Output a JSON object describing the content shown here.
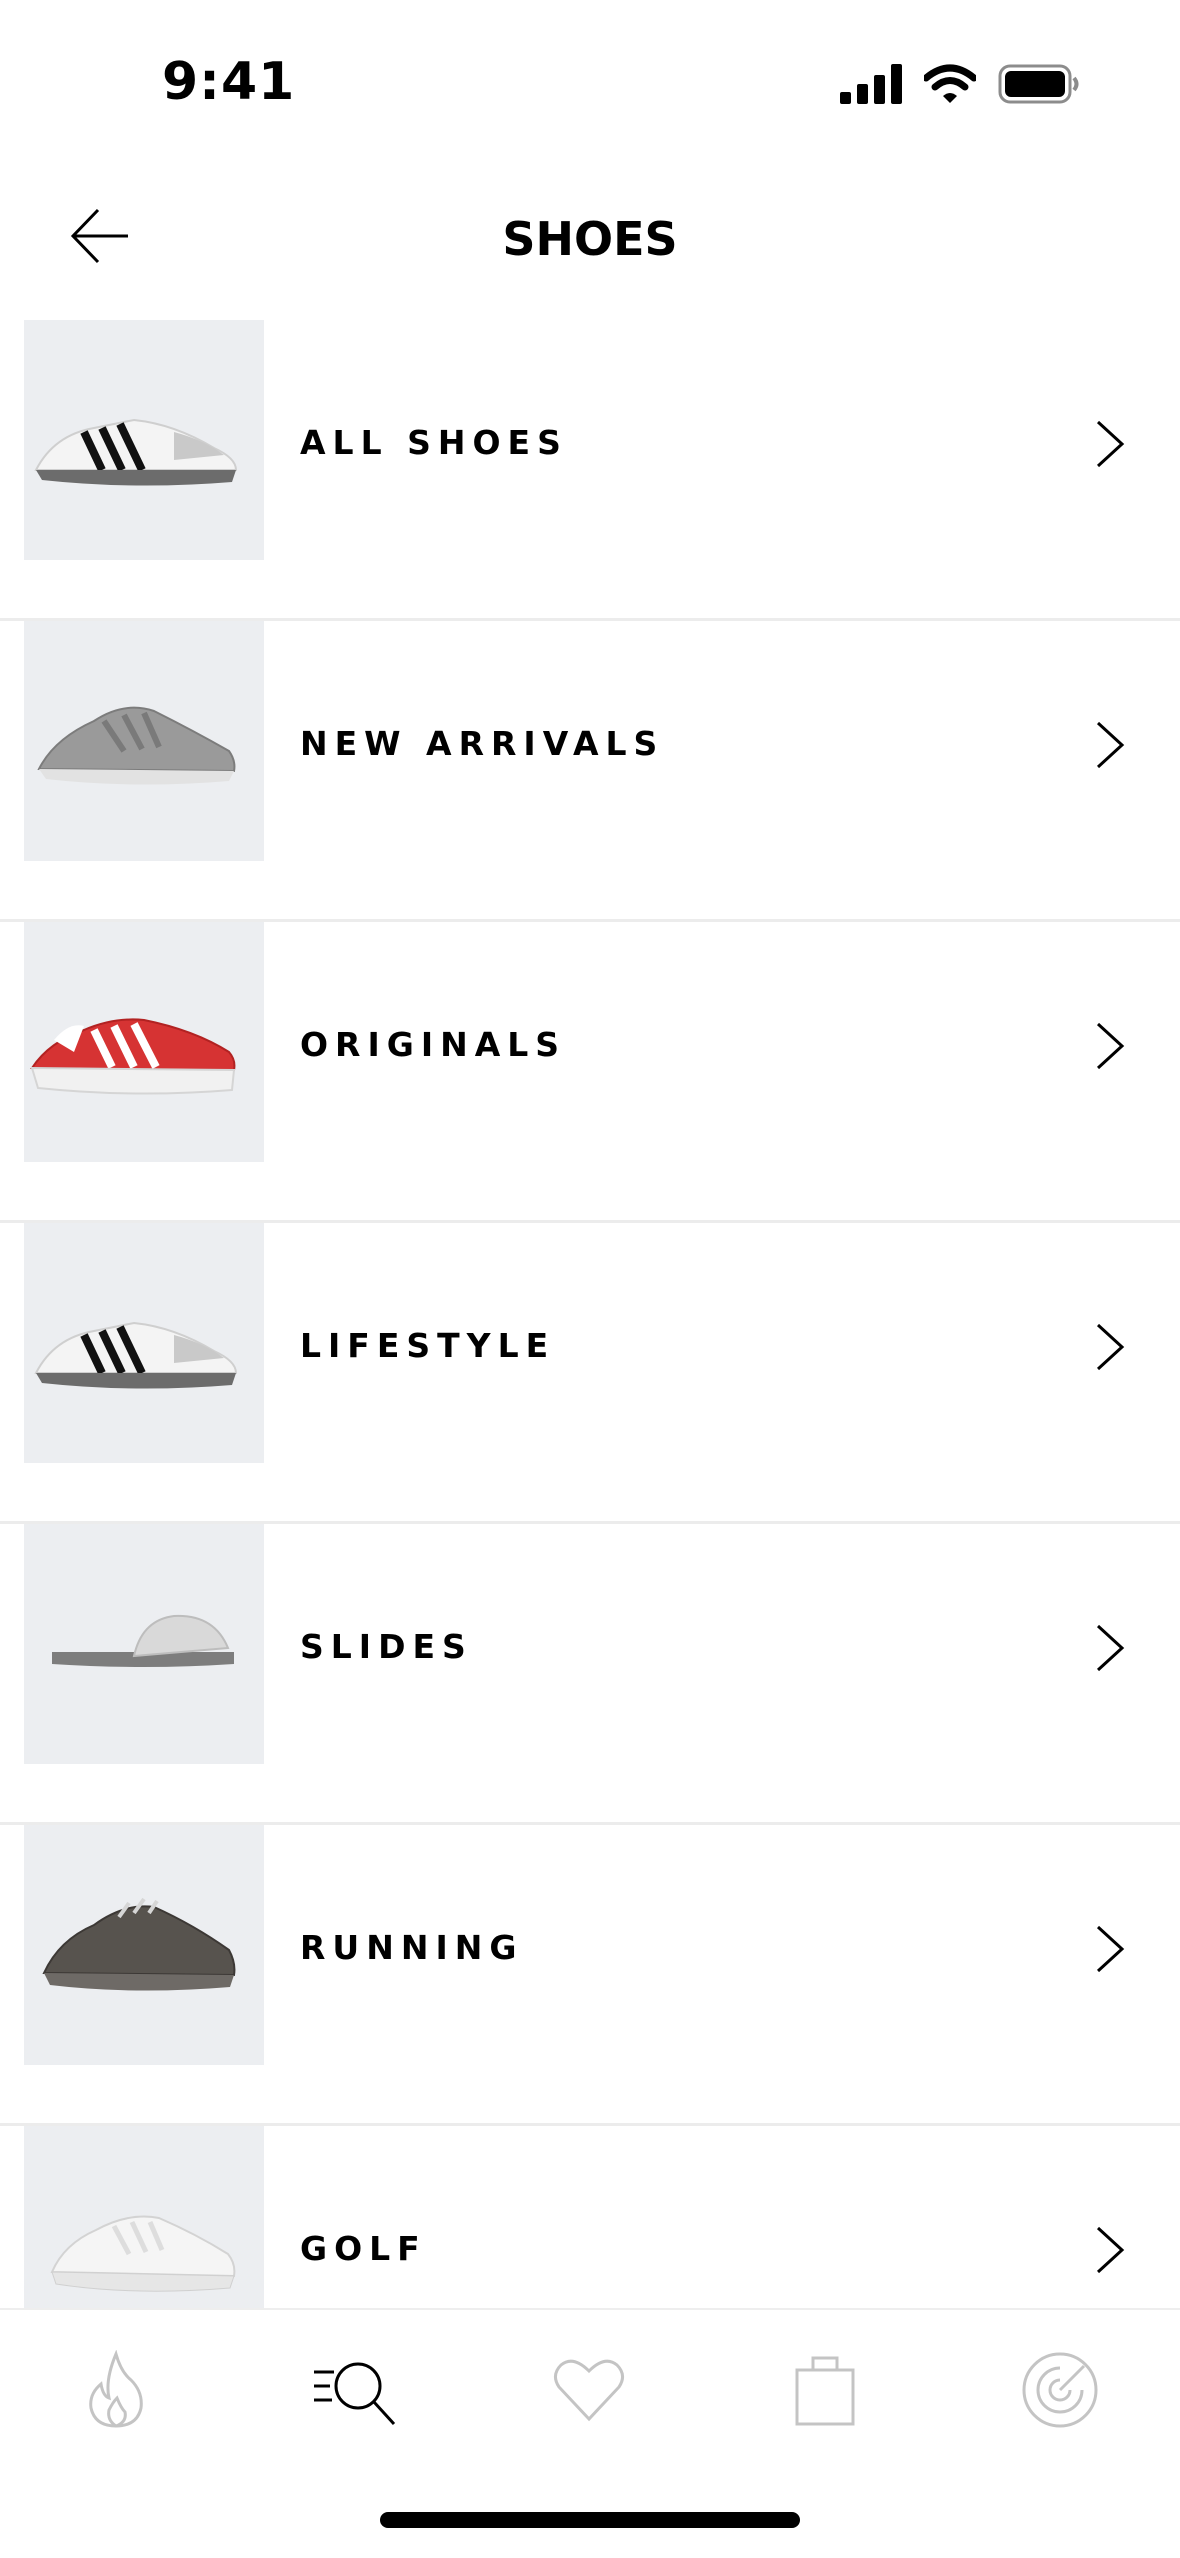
{
  "status_bar": {
    "time": "9:41",
    "icons": [
      "signal-icon",
      "wifi-icon",
      "battery-icon"
    ]
  },
  "header": {
    "title": "SHOES",
    "back_icon": "arrow-left-icon"
  },
  "categories": [
    {
      "label": "ALL SHOES",
      "image": "white-black-stripe-sneaker"
    },
    {
      "label": "NEW ARRIVALS",
      "image": "grey-running-sneaker"
    },
    {
      "label": "ORIGINALS",
      "image": "red-white-platform-sneaker"
    },
    {
      "label": "LIFESTYLE",
      "image": "white-black-stripe-sneaker"
    },
    {
      "label": "SLIDES",
      "image": "grey-slide-sandal"
    },
    {
      "label": "RUNNING",
      "image": "dark-grey-running-shoe"
    },
    {
      "label": "GOLF",
      "image": "white-golf-shoe"
    }
  ],
  "tab_bar": {
    "tabs": [
      {
        "name": "flame-icon",
        "active": false
      },
      {
        "name": "search-icon",
        "active": true
      },
      {
        "name": "heart-icon",
        "active": false
      },
      {
        "name": "bag-icon",
        "active": false
      },
      {
        "name": "radar-icon",
        "active": false
      }
    ]
  },
  "colors": {
    "thumb_bg": "#eceef1",
    "divider": "#ececec",
    "inactive_icon": "#c4c4c4",
    "active_icon": "#000000"
  }
}
